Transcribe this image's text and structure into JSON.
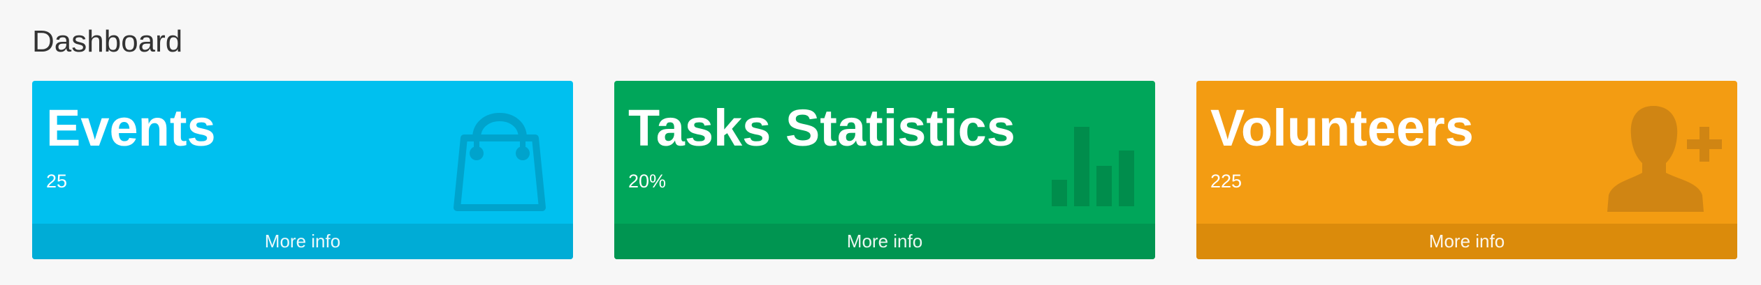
{
  "page": {
    "title": "Dashboard"
  },
  "boxes": [
    {
      "title": "Events",
      "value": "25",
      "footer_label": "More info",
      "icon": "shopping-bag-icon",
      "color": "#00c0ef",
      "footer_color": "#00acd6",
      "icon_color": "#00a3cc"
    },
    {
      "title": "Tasks Statistics",
      "value": "20%",
      "footer_label": "More info",
      "icon": "bar-chart-icon",
      "color": "#00a65a",
      "footer_color": "#009551",
      "icon_color": "#008d4c"
    },
    {
      "title": "Volunteers",
      "value": "225",
      "footer_label": "More info",
      "icon": "user-plus-icon",
      "color": "#f39c12",
      "footer_color": "#db8b0b",
      "icon_color": "#d08513"
    }
  ]
}
